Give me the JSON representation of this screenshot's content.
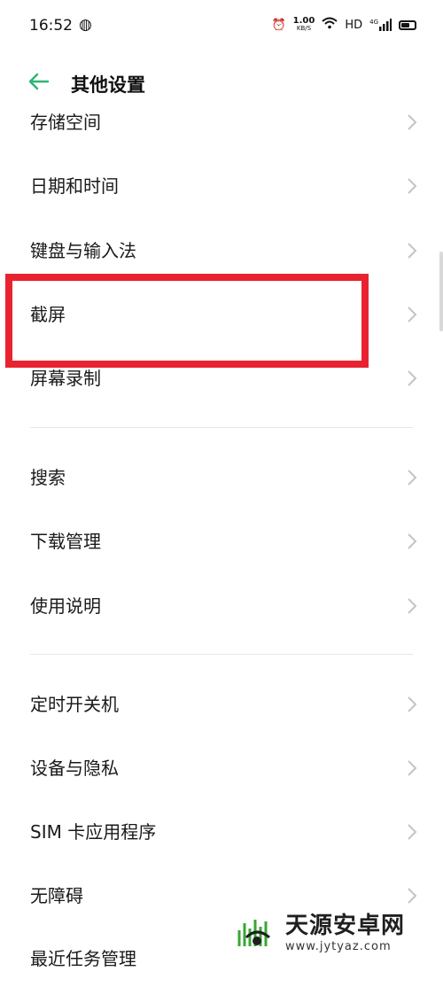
{
  "status": {
    "time": "16:52",
    "speed": "1.00",
    "speed_unit": "KB/S",
    "network": "HD",
    "signal_label": "4G"
  },
  "header": {
    "title": "其他设置"
  },
  "rows": [
    {
      "label": "存储空间"
    },
    {
      "label": "日期和时间"
    },
    {
      "label": "键盘与输入法"
    },
    {
      "label": "截屏"
    },
    {
      "label": "屏幕录制"
    },
    {
      "label": "搜索"
    },
    {
      "label": "下载管理"
    },
    {
      "label": "使用说明"
    },
    {
      "label": "定时开关机"
    },
    {
      "label": "设备与隐私"
    },
    {
      "label": "SIM 卡应用程序"
    },
    {
      "label": "无障碍"
    },
    {
      "label": "最近任务管理"
    }
  ],
  "watermark": {
    "name": "天源安卓网",
    "url": "www.jytyaz.com"
  },
  "colors": {
    "accent": "#2bb673",
    "highlight": "#e8232f",
    "chevron": "#c4c4c4"
  }
}
